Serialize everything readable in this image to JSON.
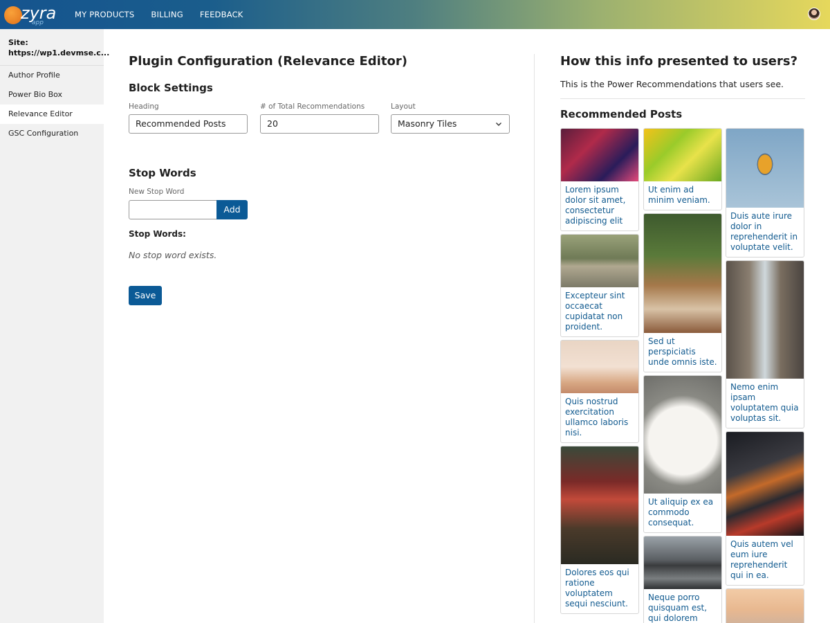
{
  "header": {
    "logo_text": "zyra",
    "logo_sub": "app",
    "nav": [
      "MY PRODUCTS",
      "BILLING",
      "FEEDBACK"
    ]
  },
  "sidebar": {
    "site_label": "Site:",
    "site_url": "https://wp1.devmse.c...",
    "items": [
      {
        "label": "Author Profile",
        "active": false
      },
      {
        "label": "Power Bio Box",
        "active": false
      },
      {
        "label": "Relevance Editor",
        "active": true
      },
      {
        "label": "GSC Configuration",
        "active": false
      }
    ]
  },
  "main": {
    "title": "Plugin Configuration (Relevance Editor)",
    "block_settings": {
      "title": "Block Settings",
      "heading_label": "Heading",
      "heading_value": "Recommended Posts",
      "total_label": "# of Total Recommendations",
      "total_value": "20",
      "layout_label": "Layout",
      "layout_value": "Masonry Tiles"
    },
    "stop_words": {
      "title": "Stop Words",
      "new_label": "New Stop Word",
      "new_value": "",
      "add_label": "Add",
      "list_label": "Stop Words:",
      "empty_text": "No stop word exists."
    },
    "save_label": "Save"
  },
  "preview": {
    "title": "How this info presented to users?",
    "description": "This is the Power Recommendations that users see.",
    "heading": "Recommended Posts",
    "columns": [
      [
        {
          "caption": "Lorem ipsum dolor sit amet, consectetur adipiscing elit",
          "image": "party-photo"
        },
        {
          "caption": "Excepteur sint occaecat cupidatat non proident.",
          "image": "cyclist-photo"
        },
        {
          "caption": "Quis nostrud exercitation ullamco laboris nisi.",
          "image": "table-setting-photo"
        },
        {
          "caption": "Dolores eos qui ratione voluptatem sequi nesciunt.",
          "image": "cafe-storefront-photo"
        }
      ],
      [
        {
          "caption": "Ut enim ad minim veniam.",
          "image": "citrus-fruit-photo"
        },
        {
          "caption": "Sed ut perspiciatis unde omnis iste.",
          "image": "garden-tea-table-photo"
        },
        {
          "caption": "Ut aliquip ex ea commodo consequat.",
          "image": "flower-plate-photo"
        },
        {
          "caption": "Neque porro quisquam est, qui dolorem",
          "image": "city-skyline-water-photo"
        }
      ],
      [
        {
          "caption": "Duis aute irure dolor in reprehenderit in voluptate velit.",
          "image": "hot-air-balloon-photo"
        },
        {
          "caption": "Nemo enim ipsam voluptatem quia voluptas sit.",
          "image": "city-street-photo"
        },
        {
          "caption": "Quis autem vel eum iure reprehenderit qui in ea.",
          "image": "night-traffic-photo"
        },
        {
          "caption": "",
          "image": "sunset-sea-photo"
        }
      ]
    ]
  }
}
